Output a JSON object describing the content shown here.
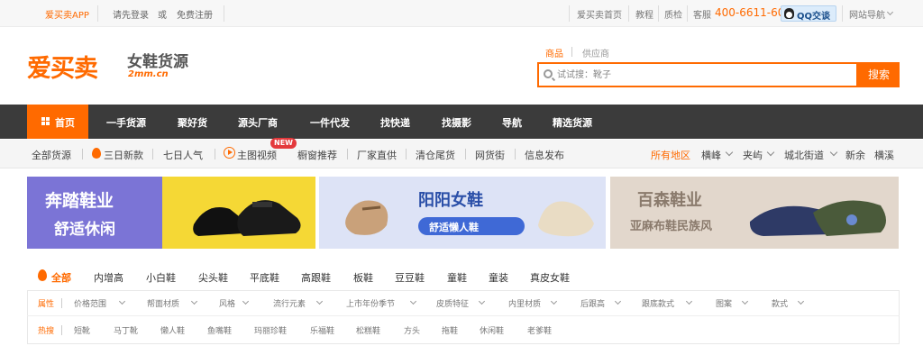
{
  "topbar": {
    "app": "爱买卖APP",
    "login": "请先登录",
    "or": "或",
    "register": "免费注册",
    "home": "爱买卖首页",
    "tutorial": "教程",
    "quality": "质检",
    "service_label": "客服",
    "phone": "400-6611-603",
    "qq": "QQ交谈",
    "site_nav": "网站导航"
  },
  "logo": {
    "brand": "爱买卖",
    "subtitle": "女鞋货源",
    "url": "2mm.cn"
  },
  "search": {
    "tab_goods": "商品",
    "tab_supplier": "供应商",
    "placeholder": "试试搜：靴子",
    "button": "搜索"
  },
  "mainnav": {
    "home": "首页",
    "items": [
      "一手货源",
      "聚好货",
      "源头厂商",
      "一件代发",
      "找快递",
      "找摄影",
      "导航",
      "精选货源"
    ]
  },
  "subnav": {
    "items": [
      "全部货源",
      "三日新款",
      "七日人气",
      "主图视频",
      "橱窗推荐",
      "厂家直供",
      "清仓尾货",
      "网货街",
      "信息发布"
    ],
    "new_badge": "NEW",
    "regions": [
      "所有地区",
      "横峰",
      "夹屿",
      "城北街道",
      "新余",
      "横溪"
    ]
  },
  "banners": [
    {
      "title": "奔踏鞋业",
      "subtitle": "舒适休闲"
    },
    {
      "title": "阳阳女鞋",
      "subtitle": "舒适懒人鞋"
    },
    {
      "title": "百森鞋业",
      "subtitle": "亚麻布鞋民族风"
    }
  ],
  "categories": [
    "全部",
    "内增高",
    "小白鞋",
    "尖头鞋",
    "平底鞋",
    "高跟鞋",
    "板鞋",
    "豆豆鞋",
    "童鞋",
    "童装",
    "真皮女鞋"
  ],
  "filters": {
    "attr_label": "属性",
    "attributes": [
      "价格范围",
      "帮面材质",
      "风格",
      "流行元素",
      "上市年份季节",
      "皮质特征",
      "内里材质",
      "后跟高",
      "跟底款式",
      "图案",
      "款式"
    ],
    "hot_label": "热搜",
    "hot": [
      "短靴",
      "马丁靴",
      "懒人鞋",
      "鱼嘴鞋",
      "玛丽珍鞋",
      "乐福鞋",
      "松糕鞋",
      "方头",
      "拖鞋",
      "休闲鞋",
      "老爹鞋"
    ]
  },
  "colors": {
    "accent": "#ff6a00",
    "nav_bg": "#3b3b3b",
    "topbar_bg": "#f7f7f7"
  }
}
